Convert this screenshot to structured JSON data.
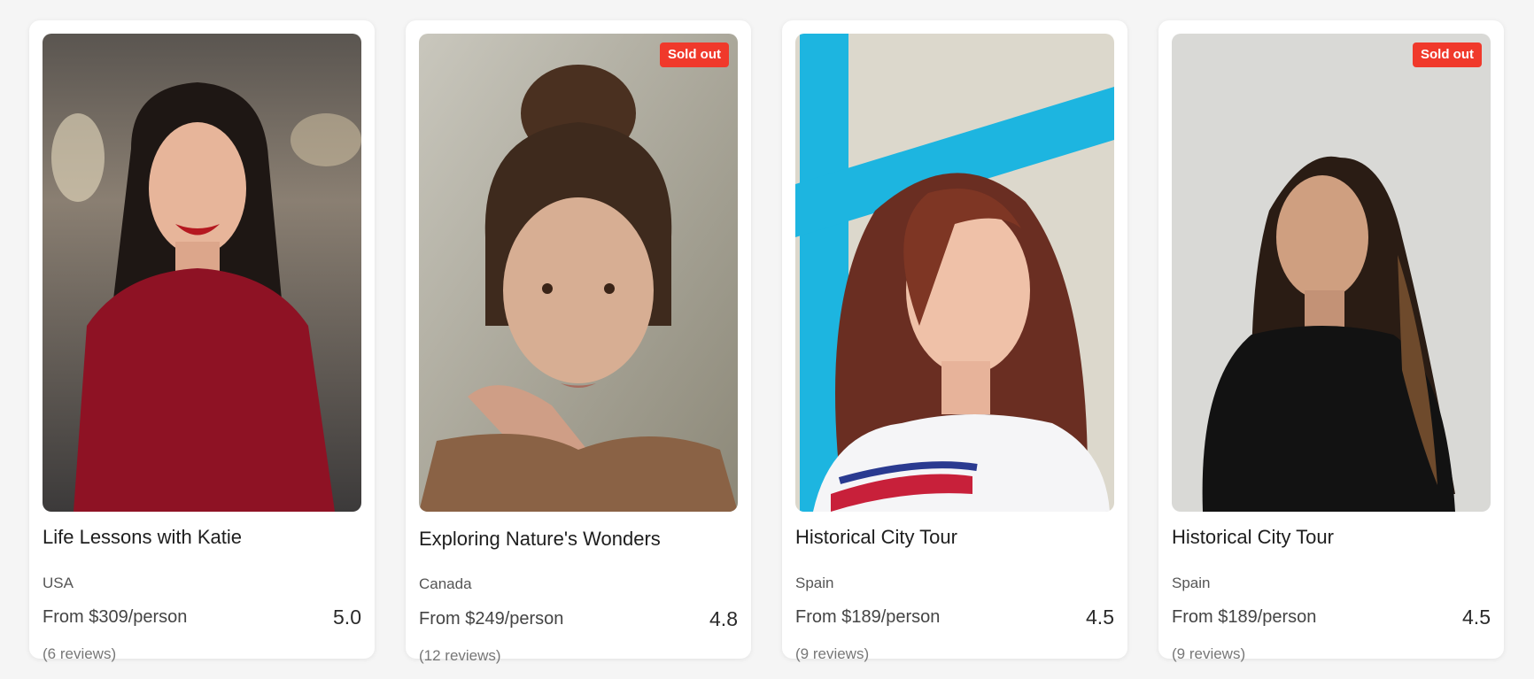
{
  "badge_label": "Sold out",
  "cards": [
    {
      "title": "Life Lessons with Katie",
      "country": "USA",
      "price": "From $309/person",
      "rating": "5.0",
      "reviews": "(6 reviews)",
      "sold_out": false
    },
    {
      "title": "Exploring Nature's Wonders",
      "country": "Canada",
      "price": "From $249/person",
      "rating": "4.8",
      "reviews": "(12 reviews)",
      "sold_out": true
    },
    {
      "title": "Historical City Tour",
      "country": "Spain",
      "price": "From $189/person",
      "rating": "4.5",
      "reviews": "(9 reviews)",
      "sold_out": false
    },
    {
      "title": "Historical City Tour",
      "country": "Spain",
      "price": "From $189/person",
      "rating": "4.5",
      "reviews": "(9 reviews)",
      "sold_out": true
    }
  ],
  "colors": {
    "badge": "#f0392b",
    "card_background": "#ffffff",
    "page_background": "#f5f5f5"
  }
}
